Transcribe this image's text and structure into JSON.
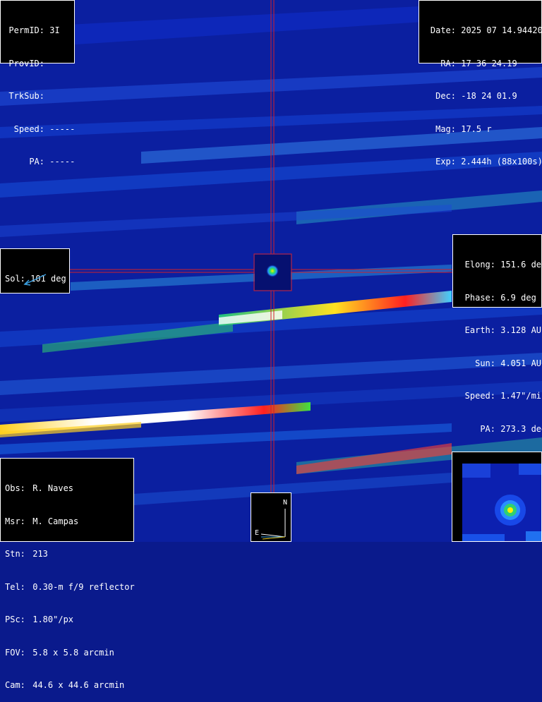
{
  "top_left": {
    "rows": [
      {
        "label": "PermID:",
        "value": "3I"
      },
      {
        "label": "ProvID:",
        "value": ""
      },
      {
        "label": "TrkSub:",
        "value": ""
      },
      {
        "label": "Speed:",
        "value": "-----"
      },
      {
        "label": "PA:",
        "value": "-----"
      }
    ]
  },
  "top_right": {
    "rows": [
      {
        "label": "Date:",
        "value": "2025 07 14.94420"
      },
      {
        "label": "RA:",
        "value": "17 36 24.19"
      },
      {
        "label": "Dec:",
        "value": "-18 24 01.9"
      },
      {
        "label": "Mag:",
        "value": "17.5 r"
      },
      {
        "label": "Exp:",
        "value": "2.444h (88x100s)"
      }
    ]
  },
  "sol": {
    "label": "Sol:",
    "value": "101 deg",
    "arrow_color": "#3a9fe0"
  },
  "right": {
    "rows": [
      {
        "label": "Elong:",
        "value": "151.6 deg"
      },
      {
        "label": "Phase:",
        "value": "6.9 deg"
      },
      {
        "label": "Earth:",
        "value": "3.128 AU"
      },
      {
        "label": "Sun:",
        "value": "4.051 AU"
      },
      {
        "label": "Speed:",
        "value": "1.47\"/min"
      },
      {
        "label": "PA:",
        "value": "273.3 deg"
      }
    ]
  },
  "bottom_left": {
    "rows": [
      {
        "label": "Obs:",
        "value": "R. Naves"
      },
      {
        "label": "Msr:",
        "value": "M. Campas"
      },
      {
        "label": "Stn:",
        "value": "213"
      },
      {
        "label": "Tel:",
        "value": "0.30-m f/9 reflector"
      },
      {
        "label": "PSc:",
        "value": "1.80\"/px"
      },
      {
        "label": "FOV:",
        "value": "5.8 x 5.8 arcmin"
      },
      {
        "label": "Cam:",
        "value": "44.6 x 44.6 arcmin"
      }
    ]
  },
  "compass": {
    "north": "N",
    "east": "E"
  },
  "colors": {
    "background": "#0a1a8c",
    "reticle": "#d0202a",
    "panel_border": "#ffffff"
  }
}
